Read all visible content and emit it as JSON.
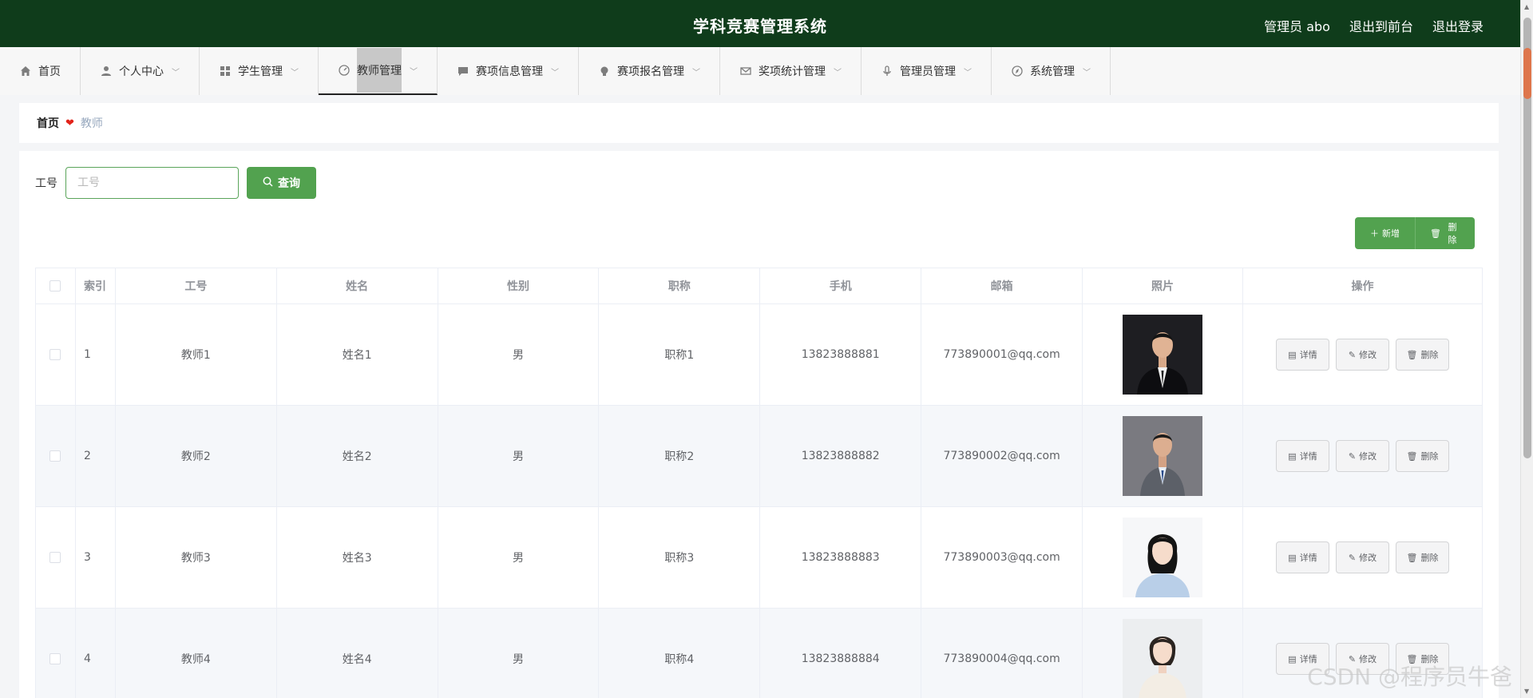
{
  "header": {
    "title": "学科竞赛管理系统",
    "user_label": "管理员 abo",
    "to_front": "退出到前台",
    "logout": "退出登录"
  },
  "nav": [
    {
      "label": "首页",
      "icon": "home-icon"
    },
    {
      "label": "个人中心",
      "icon": "user-icon"
    },
    {
      "label": "学生管理",
      "icon": "grid-icon"
    },
    {
      "label": "教师管理",
      "icon": "gauge-icon"
    },
    {
      "label": "赛项信息管理",
      "icon": "chat-icon"
    },
    {
      "label": "赛项报名管理",
      "icon": "bulb-icon"
    },
    {
      "label": "奖项统计管理",
      "icon": "mail-icon"
    },
    {
      "label": "管理员管理",
      "icon": "mic-icon"
    },
    {
      "label": "系统管理",
      "icon": "compass-icon"
    }
  ],
  "breadcrumb": {
    "home": "首页",
    "current": "教师"
  },
  "search": {
    "label": "工号",
    "placeholder": "工号",
    "value": "",
    "button": "查询"
  },
  "actions": {
    "add": "新增",
    "delete": "删除"
  },
  "table": {
    "headers": [
      "索引",
      "工号",
      "姓名",
      "性别",
      "职称",
      "手机",
      "邮箱",
      "照片",
      "操作"
    ],
    "rows": [
      {
        "idx": "1",
        "id": "教师1",
        "name": "姓名1",
        "sex": "男",
        "title": "职称1",
        "phone": "13823888881",
        "email": "773890001@qq.com"
      },
      {
        "idx": "2",
        "id": "教师2",
        "name": "姓名2",
        "sex": "男",
        "title": "职称2",
        "phone": "13823888882",
        "email": "773890002@qq.com"
      },
      {
        "idx": "3",
        "id": "教师3",
        "name": "姓名3",
        "sex": "男",
        "title": "职称3",
        "phone": "13823888883",
        "email": "773890003@qq.com"
      },
      {
        "idx": "4",
        "id": "教师4",
        "name": "姓名4",
        "sex": "男",
        "title": "职称4",
        "phone": "13823888884",
        "email": "773890004@qq.com"
      }
    ],
    "ops": {
      "detail": "详情",
      "edit": "修改",
      "delete": "删除"
    }
  },
  "watermark": "CSDN @程序员牛爸",
  "colors": {
    "header_bg": "#0f3c1b",
    "primary": "#52a24f"
  }
}
